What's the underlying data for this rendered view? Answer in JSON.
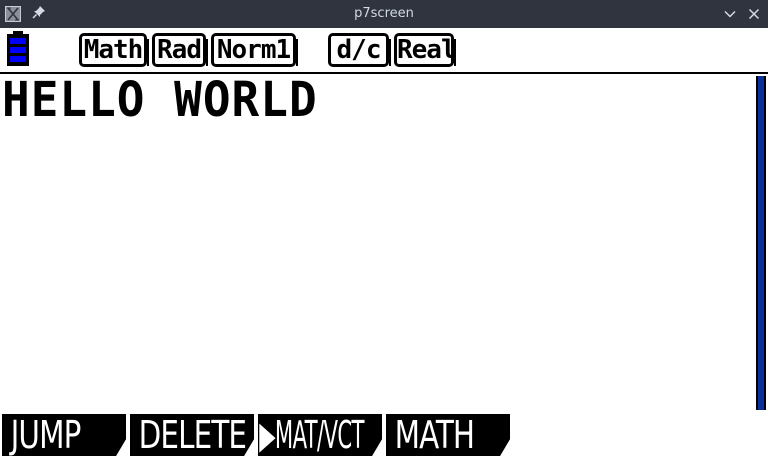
{
  "window": {
    "title": "p7screen",
    "icons": [
      "app-icon",
      "pin-icon",
      "minimize-icon",
      "close-icon"
    ]
  },
  "status_bar": {
    "battery_icon": "battery-icon",
    "badges": [
      {
        "label": "Math"
      },
      {
        "label": "Rad"
      },
      {
        "label": "Norm1"
      },
      {
        "label": "d/c"
      },
      {
        "label": "Real"
      }
    ]
  },
  "screen": {
    "output_text": "HELLO WORLD"
  },
  "function_keys": [
    {
      "label": "JUMP"
    },
    {
      "label": "DELETE"
    },
    {
      "label": "▶MAT/VCT"
    },
    {
      "label": "MATH"
    }
  ],
  "colors": {
    "titlebar_bg": "#2f343f",
    "titlebar_text": "#d3dae3",
    "battery_fill": "#0000ff",
    "scrollbar": "#0000ff",
    "screen_bg": "#ffffff",
    "ink": "#000000"
  }
}
